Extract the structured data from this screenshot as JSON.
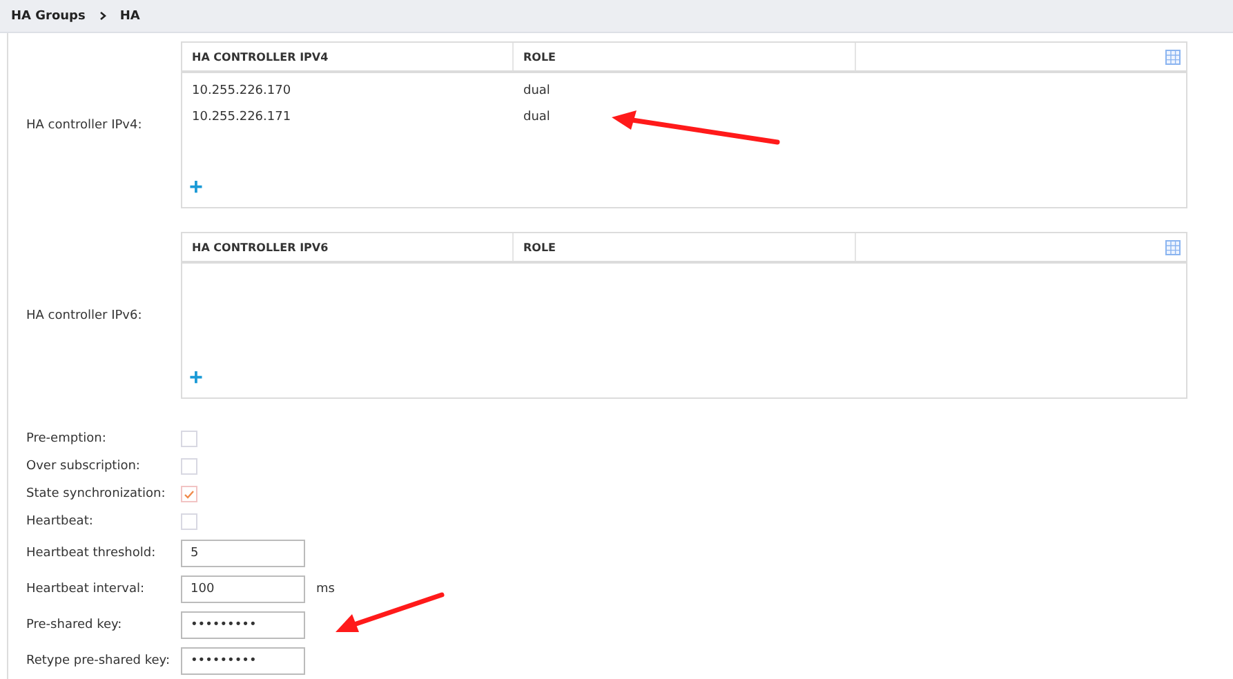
{
  "breadcrumb": [
    "HA Groups",
    "HA"
  ],
  "tables": [
    {
      "label": "HA controller IPv4:",
      "columns": [
        "HA CONTROLLER IPV4",
        "ROLE"
      ],
      "rows": [
        [
          "10.255.226.170",
          "dual"
        ],
        [
          "10.255.226.171",
          "dual"
        ]
      ],
      "add": "+"
    },
    {
      "label": "HA controller IPv6:",
      "columns": [
        "HA CONTROLLER IPV6",
        "ROLE"
      ],
      "add": "+"
    }
  ],
  "fields": [
    {
      "kind": "checkbox",
      "label": "Pre-emption:",
      "checked": false
    },
    {
      "kind": "checkbox",
      "label": "Over subscription:",
      "checked": false
    },
    {
      "kind": "checkbox",
      "label": "State synchronization:",
      "checked": true
    },
    {
      "kind": "checkbox",
      "label": "Heartbeat:",
      "checked": false
    },
    {
      "kind": "input",
      "label": "Heartbeat threshold:",
      "value": "5"
    },
    {
      "kind": "input",
      "label": "Heartbeat interval:",
      "value": "100",
      "unit": "ms"
    },
    {
      "kind": "input",
      "label": "Pre-shared key:",
      "value": "•••••••••"
    },
    {
      "kind": "input",
      "label": "Retype pre-shared key:",
      "value": "•••••••••"
    }
  ]
}
